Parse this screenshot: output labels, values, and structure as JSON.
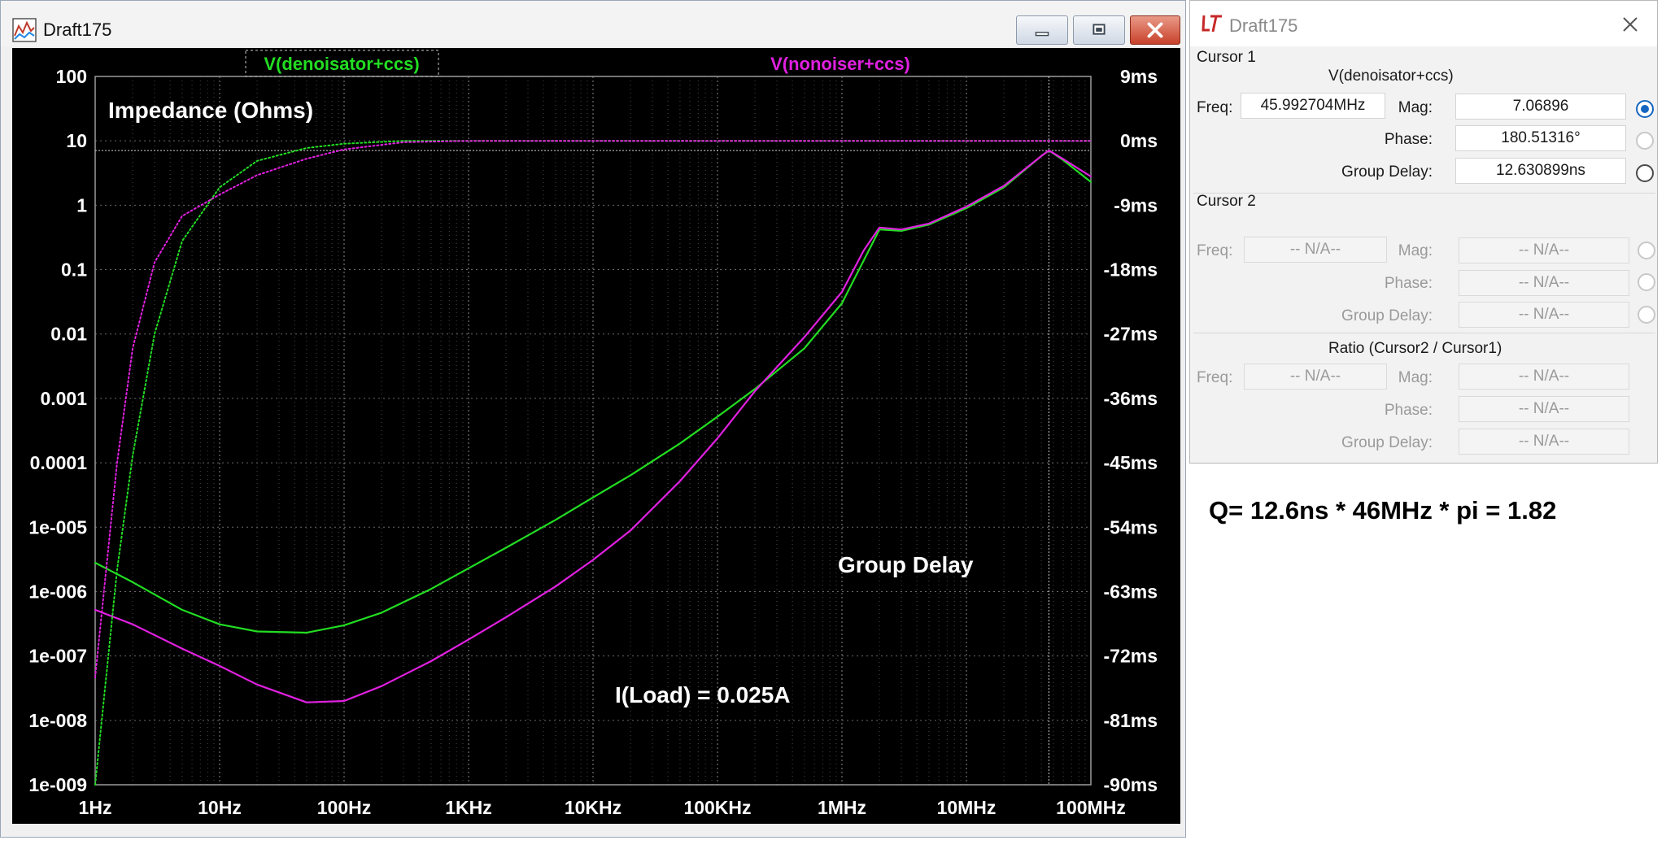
{
  "plot_window": {
    "title": "Draft175",
    "trace_labels": [
      {
        "name": "V(denoisator+ccs)",
        "color": "#22dd22"
      },
      {
        "name": "V(nonoiser+ccs)",
        "color": "#e020e0"
      }
    ],
    "annotations": {
      "impedance": "Impedance (Ohms)",
      "group_delay": "Group Delay",
      "load": "I(Load) = 0.025A"
    }
  },
  "chart_data": {
    "type": "line",
    "x_axis": {
      "scale": "log",
      "ticks": [
        "1Hz",
        "10Hz",
        "100Hz",
        "1KHz",
        "10KHz",
        "100KHz",
        "1MHz",
        "10MHz",
        "100MHz"
      ]
    },
    "y_left": {
      "scale": "log",
      "ticks": [
        "100",
        "10",
        "1",
        "0.1",
        "0.01",
        "0.001",
        "0.0001",
        "1e-005",
        "1e-006",
        "1e-007",
        "1e-008",
        "1e-009"
      ]
    },
    "y_right": {
      "ticks": [
        "9ms",
        "0ms",
        "-9ms",
        "-18ms",
        "-27ms",
        "-36ms",
        "-45ms",
        "-54ms",
        "-63ms",
        "-72ms",
        "-81ms",
        "-90ms"
      ]
    },
    "grid": true,
    "cursor": {
      "freq_hz": 45992704,
      "mag": 7.06896
    },
    "series": [
      {
        "name": "V(denoisator+ccs)",
        "color": "#22dd22",
        "style": "solid",
        "points": [
          [
            1,
            2.8e-06
          ],
          [
            2,
            1.4e-06
          ],
          [
            5,
            5.2e-07
          ],
          [
            10,
            3.1e-07
          ],
          [
            20,
            2.4e-07
          ],
          [
            50,
            2.3e-07
          ],
          [
            100,
            3e-07
          ],
          [
            200,
            4.7e-07
          ],
          [
            500,
            1.1e-06
          ],
          [
            1000,
            2.3e-06
          ],
          [
            2000,
            4.8e-06
          ],
          [
            5000,
            1.3e-05
          ],
          [
            10000,
            2.9e-05
          ],
          [
            20000,
            6.4e-05
          ],
          [
            50000,
            0.0002
          ],
          [
            100000,
            0.00052
          ],
          [
            200000,
            0.0014
          ],
          [
            500000,
            0.006
          ],
          [
            1000000,
            0.03
          ],
          [
            1500000,
            0.14
          ],
          [
            2000000,
            0.42
          ],
          [
            3000000,
            0.4
          ],
          [
            5000000,
            0.5
          ],
          [
            10000000,
            0.9
          ],
          [
            20000000,
            1.9
          ],
          [
            40000000,
            5.8
          ],
          [
            46000000,
            7.1
          ],
          [
            60000000,
            5.0
          ],
          [
            100000000,
            2.3
          ]
        ]
      },
      {
        "name": "V(nonoiser+ccs)",
        "color": "#e020e0",
        "style": "solid",
        "points": [
          [
            1,
            5.2e-07
          ],
          [
            2,
            3.1e-07
          ],
          [
            5,
            1.3e-07
          ],
          [
            10,
            7e-08
          ],
          [
            20,
            3.6e-08
          ],
          [
            50,
            1.9e-08
          ],
          [
            100,
            2e-08
          ],
          [
            200,
            3.4e-08
          ],
          [
            500,
            8.3e-08
          ],
          [
            1000,
            1.8e-07
          ],
          [
            2000,
            4e-07
          ],
          [
            5000,
            1.2e-06
          ],
          [
            10000,
            3.1e-06
          ],
          [
            20000,
            8.9e-06
          ],
          [
            50000,
            5.2e-05
          ],
          [
            100000,
            0.00024
          ],
          [
            200000,
            0.0013
          ],
          [
            500000,
            0.009
          ],
          [
            1000000,
            0.045
          ],
          [
            1500000,
            0.2
          ],
          [
            2000000,
            0.45
          ],
          [
            3000000,
            0.42
          ],
          [
            5000000,
            0.52
          ],
          [
            10000000,
            0.95
          ],
          [
            20000000,
            2.0
          ],
          [
            40000000,
            5.8
          ],
          [
            46000000,
            7.1
          ],
          [
            60000000,
            5.2
          ],
          [
            100000000,
            2.8
          ]
        ]
      },
      {
        "name": "V(denoisator+ccs) group delay",
        "color": "#22dd22",
        "style": "dotted",
        "points": [
          [
            1,
            -90
          ],
          [
            1.5,
            -60
          ],
          [
            2,
            -44
          ],
          [
            3,
            -27
          ],
          [
            5,
            -14
          ],
          [
            10,
            -6.5
          ],
          [
            20,
            -2.8
          ],
          [
            50,
            -1.0
          ],
          [
            100,
            -0.4
          ],
          [
            300,
            0
          ],
          [
            1000,
            0
          ],
          [
            100000000,
            0
          ]
        ]
      },
      {
        "name": "V(nonoiser+ccs) group delay",
        "color": "#e020e0",
        "style": "dotted",
        "points": [
          [
            1,
            -75
          ],
          [
            1.5,
            -45
          ],
          [
            2,
            -29
          ],
          [
            3,
            -17
          ],
          [
            5,
            -10.5
          ],
          [
            10,
            -7.5
          ],
          [
            20,
            -4.8
          ],
          [
            50,
            -2.5
          ],
          [
            100,
            -1.2
          ],
          [
            300,
            -0.2
          ],
          [
            1000,
            0
          ],
          [
            100000000,
            0
          ]
        ]
      }
    ]
  },
  "cursor_dialog": {
    "title": "Draft175",
    "cursor1": {
      "header": "Cursor 1",
      "trace": "V(denoisator+ccs)",
      "freq_label": "Freq:",
      "freq": "45.992704MHz",
      "mag_label": "Mag:",
      "mag": "7.06896",
      "phase_label": "Phase:",
      "phase": "180.51316°",
      "gd_label": "Group Delay:",
      "gd": "12.630899ns",
      "selected_mode": "Mag"
    },
    "cursor2": {
      "header": "Cursor 2",
      "freq_label": "Freq:",
      "freq": "-- N/A--",
      "mag_label": "Mag:",
      "mag": "-- N/A--",
      "phase_label": "Phase:",
      "phase": "-- N/A--",
      "gd_label": "Group Delay:",
      "gd": "-- N/A--"
    },
    "ratio": {
      "header": "Ratio (Cursor2 / Cursor1)",
      "freq_label": "Freq:",
      "freq": "-- N/A--",
      "mag_label": "Mag:",
      "mag": "-- N/A--",
      "phase_label": "Phase:",
      "phase": "-- N/A--",
      "gd_label": "Group Delay:",
      "gd": "-- N/A--"
    }
  },
  "annotation_q": "Q= 12.6ns * 46MHz * pi = 1.82"
}
